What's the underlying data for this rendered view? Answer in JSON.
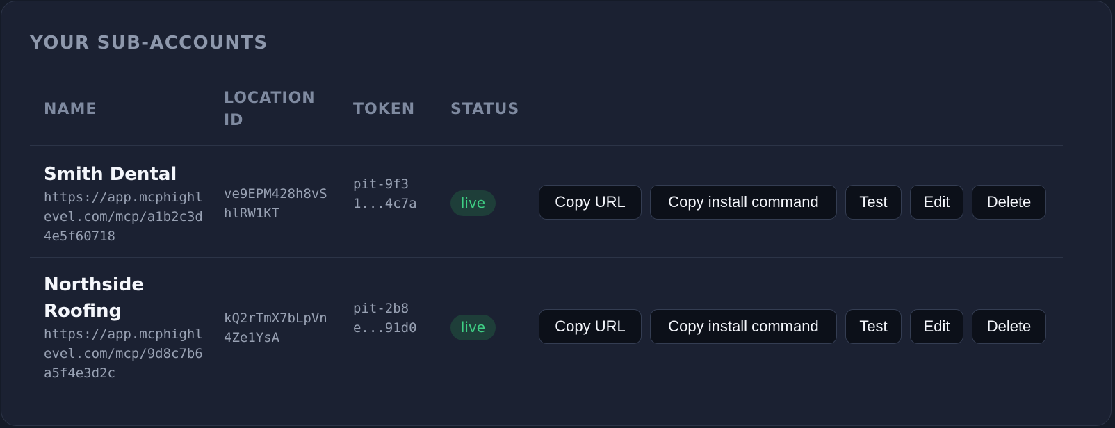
{
  "panel": {
    "title": "YOUR SUB-ACCOUNTS"
  },
  "table": {
    "headers": {
      "name": "NAME",
      "location_id": "LOCATION ID",
      "token": "TOKEN",
      "status": "STATUS"
    },
    "rows": [
      {
        "name": "Smith Dental",
        "url": "https://app.mcphighlevel.com/mcp/a1b2c3d4e5f60718",
        "location_id": "ve9EPM428h8vShlRW1KT",
        "token": "pit-9f31...4c7a",
        "status": "live"
      },
      {
        "name": "Northside Roofing",
        "url": "https://app.mcphighlevel.com/mcp/9d8c7b6a5f4e3d2c",
        "location_id": "kQ2rTmX7bLpVn4Ze1YsA",
        "token": "pit-2b8e...91d0",
        "status": "live"
      }
    ]
  },
  "actions": {
    "copy_url": "Copy URL",
    "copy_install": "Copy install command",
    "test": "Test",
    "edit": "Edit",
    "delete": "Delete"
  },
  "colors": {
    "background": "#1b2132",
    "status_live_text": "#3ecf84",
    "status_live_bg": "#1e3e39",
    "button_bg": "#0c1019"
  }
}
